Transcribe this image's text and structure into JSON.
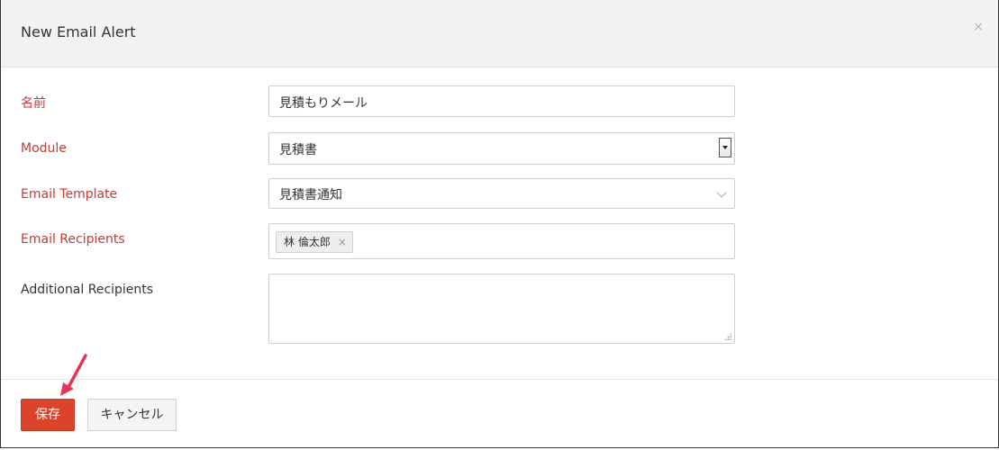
{
  "dialog": {
    "title": "New Email Alert",
    "close_glyph": "×"
  },
  "form": {
    "name": {
      "label": "名前",
      "value": "見積もりメール"
    },
    "module": {
      "label": "Module",
      "selected": "見積書"
    },
    "email_template": {
      "label": "Email Template",
      "selected": "見積書通知"
    },
    "email_recipients": {
      "label": "Email Recipients",
      "chips": [
        {
          "name": "林 倫太郎",
          "remove_glyph": "×"
        }
      ]
    },
    "additional_recipients": {
      "label": "Additional Recipients",
      "value": ""
    }
  },
  "footer": {
    "save_label": "保存",
    "cancel_label": "キャンセル"
  },
  "colors": {
    "required_label": "#c23b3b",
    "primary_button": "#d9442a",
    "annotation_arrow": "#e8335a"
  },
  "icons": {
    "close": "close-icon",
    "select_dropdown": "dropdown-arrow-icon",
    "template_chevron": "chevron-down-icon",
    "chip_remove": "remove-chip-icon",
    "annotation": "pointer-arrow-icon"
  }
}
